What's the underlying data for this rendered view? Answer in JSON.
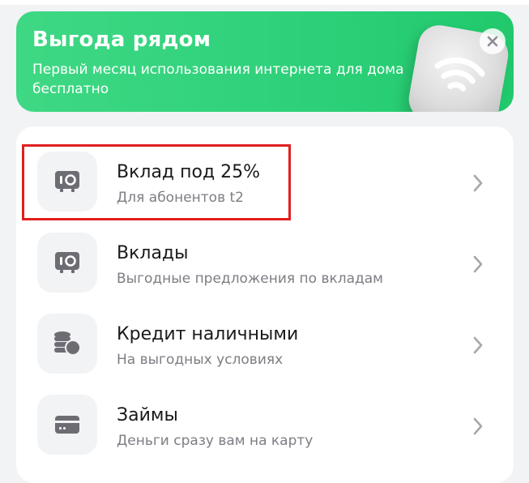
{
  "promo": {
    "title": "Выгода рядом",
    "subtitle": "Первый месяц использования интернета для дома бесплатно",
    "image_icon": "wifi-router-icon",
    "close_icon": "close-icon"
  },
  "list": {
    "items": [
      {
        "title": "Вклад под 25%",
        "subtitle": "Для абонентов t2",
        "icon": "safe-icon"
      },
      {
        "title": "Вклады",
        "subtitle": "Выгодные предложения по вкладам",
        "icon": "safe-icon"
      },
      {
        "title": "Кредит наличными",
        "subtitle": "На выгодных условиях",
        "icon": "coins-icon"
      },
      {
        "title": "Займы",
        "subtitle": "Деньги сразу вам на карту",
        "icon": "card-icon"
      }
    ]
  },
  "colors": {
    "promo_green": "#2ed17a",
    "highlight_red": "#e01f1f",
    "icon_gray": "#6c6c72",
    "chevron_gray": "#a6a6ab"
  }
}
